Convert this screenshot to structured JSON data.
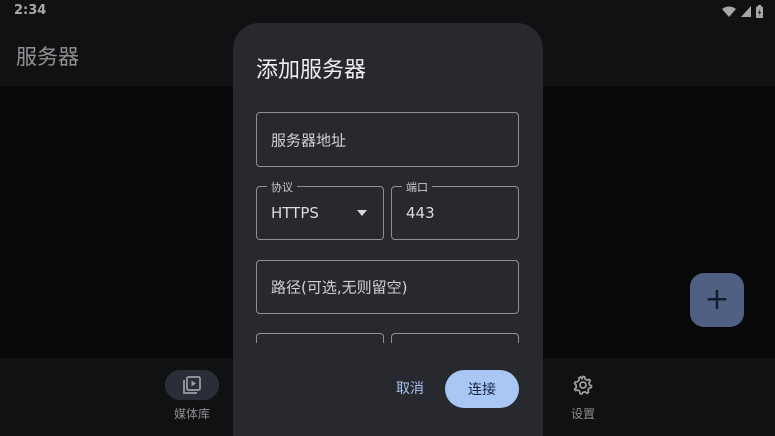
{
  "status_bar": {
    "time": "2:34"
  },
  "app_bar": {
    "title": "服务器"
  },
  "fab": {
    "icon": "add-icon",
    "label": "+"
  },
  "bottom_nav": {
    "items": [
      {
        "label": "媒体库",
        "icon": "video-library-icon",
        "active": true
      },
      {
        "label": "设置",
        "icon": "gear-icon",
        "active": false
      }
    ]
  },
  "dialog": {
    "title": "添加服务器",
    "server_address": {
      "placeholder": "服务器地址",
      "value": ""
    },
    "protocol": {
      "label": "协议",
      "value": "HTTPS"
    },
    "port": {
      "label": "端口",
      "value": "443"
    },
    "path": {
      "placeholder": "路径(可选,无则留空)",
      "value": ""
    },
    "cancel_label": "取消",
    "connect_label": "连接"
  },
  "colors": {
    "accent": "#a9c7f5",
    "fab": "#6f86b4",
    "dialog_bg": "#27292e",
    "bar_bg": "#17181b"
  }
}
